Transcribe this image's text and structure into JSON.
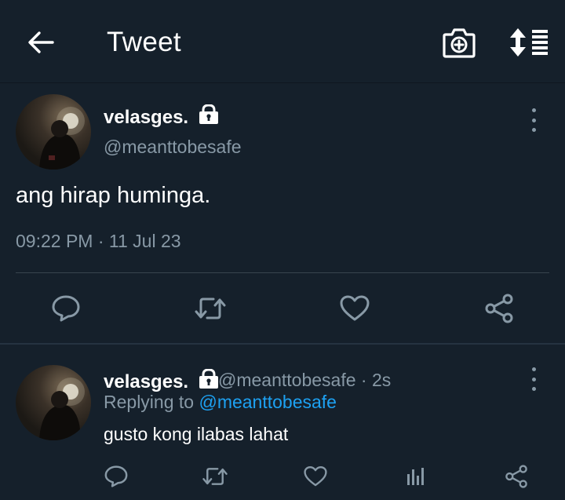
{
  "header": {
    "title": "Tweet",
    "back_icon": "arrow-left-icon",
    "camera_icon": "camera-plus-icon",
    "sort_icon": "sort-list-icon"
  },
  "main_tweet": {
    "display_name": "velasges.",
    "handle": "@meanttobesafe",
    "text": "ang hirap huminga.",
    "time": "09:22 PM",
    "separator": "·",
    "date": "11 Jul 23",
    "protected": true
  },
  "reply": {
    "display_name": "velasges.",
    "handle": "@meanttobesafe",
    "age": "· 2s",
    "replying_prefix": "Replying to",
    "replying_handle": "@meanttobesafe",
    "text": "gusto kong ilabas lahat",
    "protected": true
  },
  "colors": {
    "background": "#15202b",
    "muted": "#8899a6",
    "link": "#1da1f2",
    "divider": "#38444d"
  }
}
